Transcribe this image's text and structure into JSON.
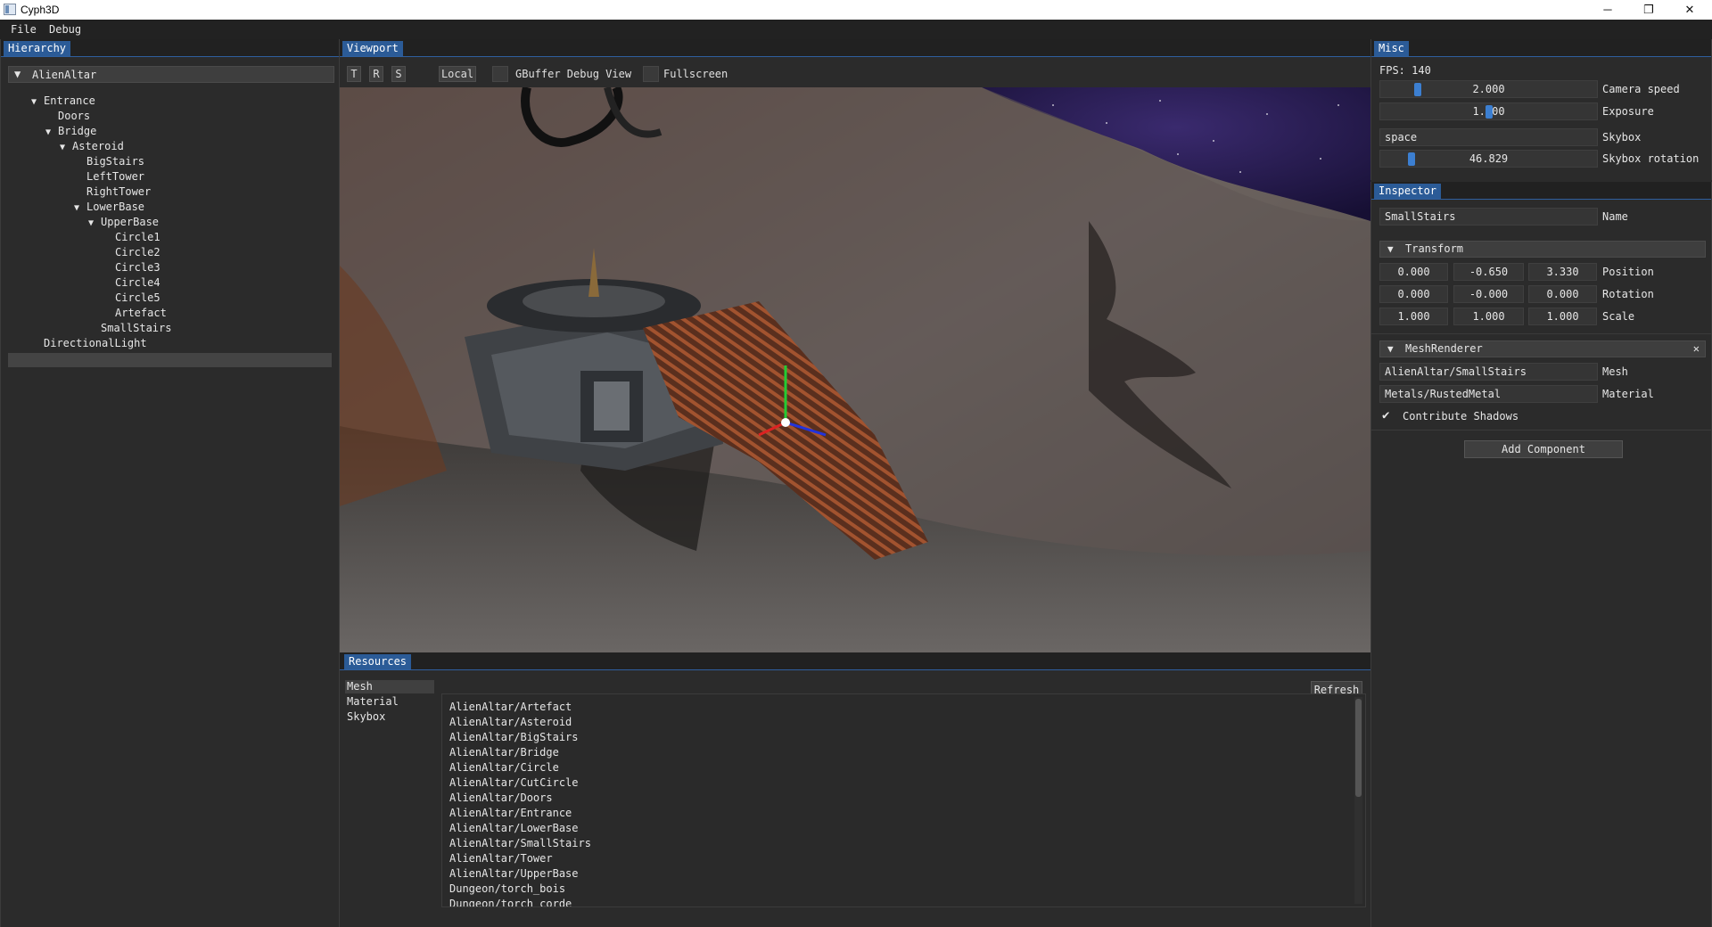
{
  "window": {
    "title": "Cyph3D",
    "controls": {
      "minimize": "─",
      "maximize": "❐",
      "close": "✕"
    }
  },
  "menu": [
    "File",
    "Debug"
  ],
  "hierarchy": {
    "tab": "Hierarchy",
    "root": {
      "arrow": "▼",
      "label": "AlienAltar"
    },
    "nodes": [
      {
        "label": "Entrance",
        "caret": "▼",
        "depth": 0
      },
      {
        "label": "Doors",
        "caret": "",
        "depth": 1
      },
      {
        "label": "Bridge",
        "caret": "▼",
        "depth": 1
      },
      {
        "label": "Asteroid",
        "caret": "▼",
        "depth": 2
      },
      {
        "label": "BigStairs",
        "caret": "",
        "depth": 3
      },
      {
        "label": "LeftTower",
        "caret": "",
        "depth": 3
      },
      {
        "label": "RightTower",
        "caret": "",
        "depth": 3
      },
      {
        "label": "LowerBase",
        "caret": "▼",
        "depth": 3
      },
      {
        "label": "UpperBase",
        "caret": "▼",
        "depth": 4
      },
      {
        "label": "Circle1",
        "caret": "",
        "depth": 5
      },
      {
        "label": "Circle2",
        "caret": "",
        "depth": 5
      },
      {
        "label": "Circle3",
        "caret": "",
        "depth": 5
      },
      {
        "label": "Circle4",
        "caret": "",
        "depth": 5
      },
      {
        "label": "Circle5",
        "caret": "",
        "depth": 5
      },
      {
        "label": "Artefact",
        "caret": "",
        "depth": 5
      },
      {
        "label": "SmallStairs",
        "caret": "",
        "depth": 4,
        "selected": true
      },
      {
        "label": "DirectionalLight",
        "caret": "",
        "depth": 0
      }
    ]
  },
  "viewport": {
    "tab": "Viewport",
    "buttons": {
      "translate": "T",
      "rotate": "R",
      "scale": "S",
      "space": "Local"
    },
    "gbuffer_label": "GBuffer Debug View",
    "fullscreen_label": "Fullscreen"
  },
  "misc": {
    "tab": "Misc",
    "fps": "FPS: 140",
    "camera_speed": {
      "value": "2.000",
      "label": "Camera speed",
      "level": 0.16
    },
    "exposure": {
      "value": "1.000",
      "label": "Exposure",
      "level": 0.5
    },
    "skybox": {
      "value": "space",
      "label": "Skybox"
    },
    "skybox_rotation": {
      "value": "46.829",
      "label": "Skybox rotation",
      "level": 0.13
    }
  },
  "inspector": {
    "tab": "Inspector",
    "name": {
      "value": "SmallStairs",
      "label": "Name"
    },
    "transform": {
      "caret": "▼",
      "title": "Transform",
      "position": {
        "x": "0.000",
        "y": "-0.650",
        "z": "3.330",
        "label": "Position"
      },
      "rotation": {
        "x": "0.000",
        "y": "-0.000",
        "z": "0.000",
        "label": "Rotation"
      },
      "scale": {
        "x": "1.000",
        "y": "1.000",
        "z": "1.000",
        "label": "Scale"
      }
    },
    "mesh_renderer": {
      "caret": "▼",
      "title": "MeshRenderer",
      "close": "✕",
      "mesh": {
        "value": "AlienAltar/SmallStairs",
        "label": "Mesh"
      },
      "material": {
        "value": "Metals/RustedMetal",
        "label": "Material"
      },
      "contribute_shadows": {
        "check": "✔",
        "label": "Contribute Shadows"
      }
    },
    "add_component": "Add Component"
  },
  "resources": {
    "tab": "Resources",
    "categories": [
      "Mesh",
      "Material",
      "Skybox"
    ],
    "refresh": "Refresh",
    "items": [
      "AlienAltar/Artefact",
      "AlienAltar/Asteroid",
      "AlienAltar/BigStairs",
      "AlienAltar/Bridge",
      "AlienAltar/Circle",
      "AlienAltar/CutCircle",
      "AlienAltar/Doors",
      "AlienAltar/Entrance",
      "AlienAltar/LowerBase",
      "AlienAltar/SmallStairs",
      "AlienAltar/Tower",
      "AlienAltar/UpperBase",
      "Dungeon/torch_bois",
      "Dungeon/torch_corde"
    ]
  },
  "colors": {
    "accent": "#2b5b97",
    "slider": "#3c7fd1",
    "panel_bg": "#2b2b2b",
    "field_bg": "#353535"
  }
}
